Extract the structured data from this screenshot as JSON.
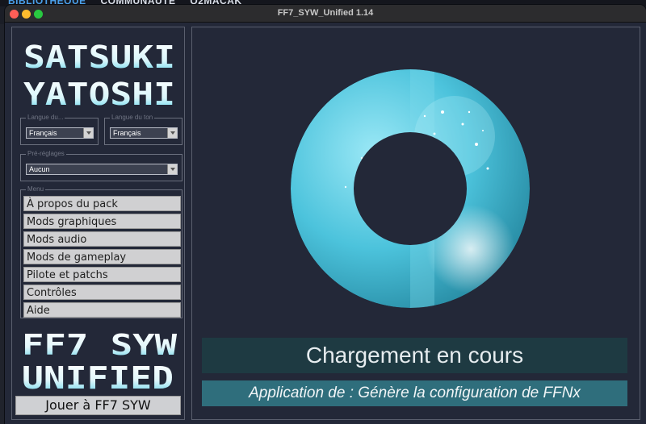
{
  "background_menu": {
    "item1": "BIBLIOTHÈQUE",
    "item2": "COMMUNAUTÉ",
    "item3": "Q2MACAK"
  },
  "window": {
    "title": "FF7_SYW_Unified 1.14"
  },
  "sidebar": {
    "logo_line1": "SATSUKI",
    "logo_line2": "YATOSHI",
    "text_lang_label": "Langue du...",
    "text_lang_value": "Français",
    "voice_lang_label": "Langue du ton",
    "voice_lang_value": "Français",
    "preset_label": "Pré-réglages",
    "preset_value": "Aucun",
    "menu_label": "Menu",
    "menu_items": [
      "À propos du pack",
      "Mods graphiques",
      "Mods audio",
      "Mods de gameplay",
      "Pilote et patchs",
      "Contrôles",
      "Aide"
    ],
    "ff7_line1": "FF7 SYW",
    "ff7_line2": "UNIFIED",
    "play_label": "Jouer à FF7 SYW"
  },
  "main": {
    "status_title": "Chargement en cours",
    "status_detail": "Application de : Génère la configuration de FFNx"
  },
  "colors": {
    "accent": "#4fc6dc",
    "status_title_bg": "#1e3a42",
    "status_detail_bg": "#2f6e7c",
    "window_bg": "#232838"
  }
}
